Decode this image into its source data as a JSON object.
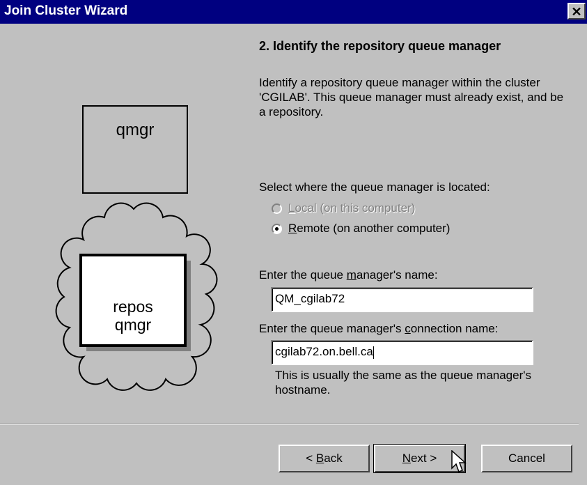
{
  "window": {
    "title": "Join Cluster Wizard",
    "close_glyph": "✕"
  },
  "diagram": {
    "qmgr_label": "qmgr",
    "repos_line1": "repos",
    "repos_line2": "qmgr"
  },
  "step": {
    "heading": "2. Identify the repository queue manager",
    "description": "Identify a repository queue manager within the cluster 'CGILAB'. This queue manager must already exist, and be a repository."
  },
  "location": {
    "prompt": "Select where the queue manager is located:",
    "options": [
      {
        "mnemonic": "L",
        "rest": "ocal (on this computer)",
        "selected": false,
        "enabled": false
      },
      {
        "mnemonic": "R",
        "rest": "emote (on another computer)",
        "selected": true,
        "enabled": true
      }
    ]
  },
  "qmgr_name": {
    "label_pre": "Enter the queue ",
    "label_mnemonic": "m",
    "label_post": "anager's name:",
    "value": "QM_cgilab72"
  },
  "conn_name": {
    "label_pre": "Enter the queue manager's ",
    "label_mnemonic": "c",
    "label_post": "onnection name:",
    "value": "cgilab72.on.bell.ca",
    "hint": "This is usually the same as the queue manager's hostname."
  },
  "buttons": {
    "back_pre": "< ",
    "back_mnemonic": "B",
    "back_post": "ack",
    "next_mnemonic": "N",
    "next_post": "ext >",
    "cancel": "Cancel"
  },
  "icons": {
    "cursor": "arrow-cursor-icon"
  }
}
